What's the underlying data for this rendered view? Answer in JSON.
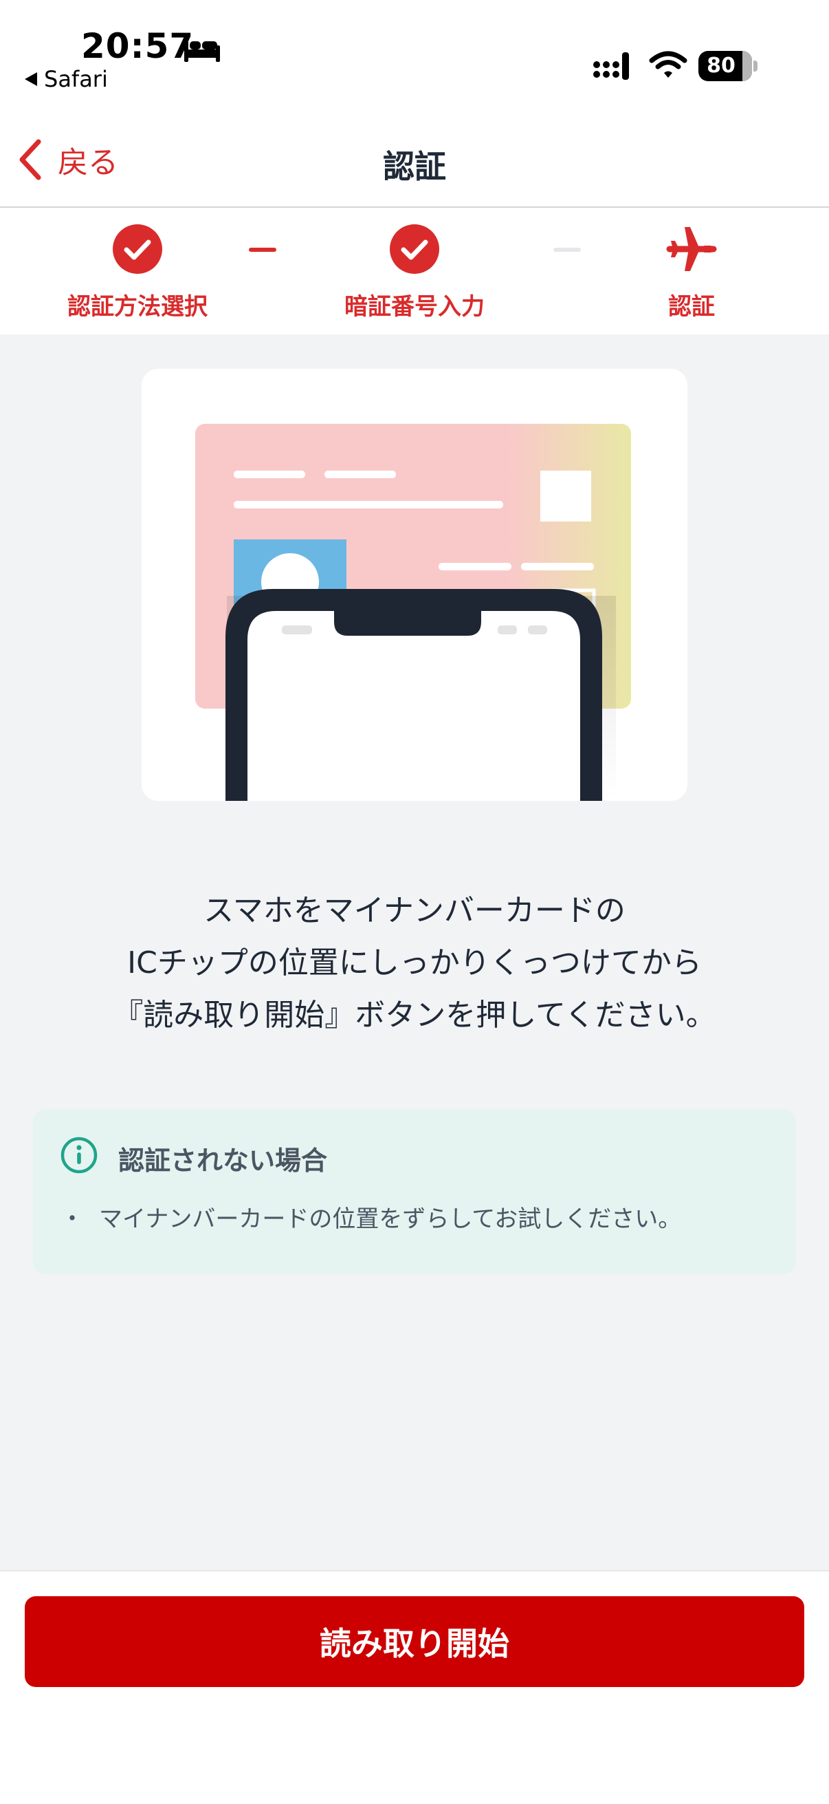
{
  "status_bar": {
    "time": "20:57",
    "back_app": "Safari",
    "battery": "80",
    "battery_level": 0.8,
    "icons": [
      "bed-icon",
      "signal-icon",
      "wifi-icon",
      "battery-icon"
    ]
  },
  "nav": {
    "back_label": "戻る",
    "title": "認証"
  },
  "stepper": {
    "steps": [
      {
        "label": "認証方法選択",
        "state": "done",
        "icon": "check-circle-icon"
      },
      {
        "label": "暗証番号入力",
        "state": "done",
        "icon": "check-circle-icon"
      },
      {
        "label": "認証",
        "state": "current",
        "icon": "airplane-icon"
      }
    ]
  },
  "main": {
    "instruction_lines": [
      "スマホをマイナンバーカードの",
      "ICチップの位置にしっかりくっつけてから",
      "『読み取り開始』ボタンを押してください。"
    ],
    "info": {
      "icon": "info-icon",
      "title": "認証されない場合",
      "bullet": "・",
      "items": [
        "マイナンバーカードの位置をずらしてお試しください。"
      ]
    }
  },
  "footer": {
    "start_label": "読み取り開始"
  },
  "colors": {
    "accent_red": "#d92b2b",
    "button_red": "#cc0000",
    "info_green": "#1ea58a",
    "info_bg": "#e6f4f1",
    "background": "#f2f3f5"
  }
}
